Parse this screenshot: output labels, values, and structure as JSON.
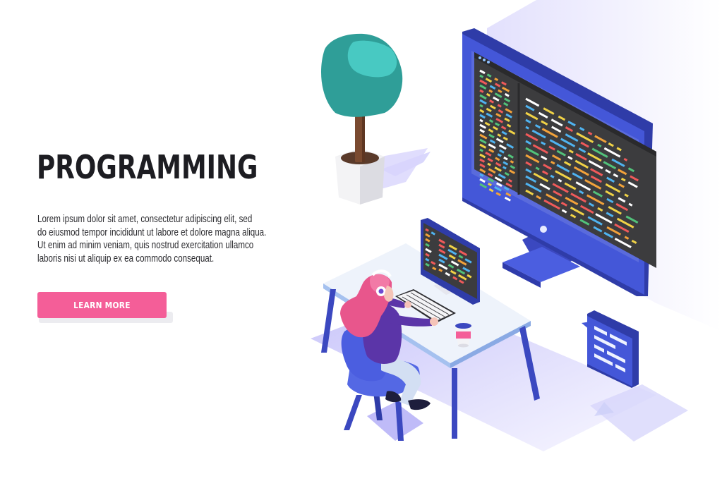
{
  "hero": {
    "title": "PROGRAMMING",
    "body_lines": [
      "Lorem ipsum dolor sit amet, consectetur adipiscing elit, sed",
      "do eiusmod tempor incididunt ut labore et dolore magna aliqua.",
      "Ut enim ad minim veniam, quis nostrud exercitation ullamco",
      "laboris nisi ut aliquip ex ea commodo consequat."
    ],
    "cta_label": "LEARN MORE"
  },
  "colors": {
    "accent": "#f45e98",
    "monitor_blue": "#4457d8",
    "screen_dark": "#3c3c3e",
    "plant_green": "#2f9e98",
    "shadow_lavender": "#b8b4f7"
  },
  "icons": {
    "big_monitor": "desktop-monitor-icon",
    "small_monitor": "laptop-screen-icon",
    "chat_bubble": "code-chat-bubble-icon",
    "plant": "potted-plant-icon",
    "coffee": "coffee-cup-icon",
    "developer": "developer-person-icon"
  }
}
